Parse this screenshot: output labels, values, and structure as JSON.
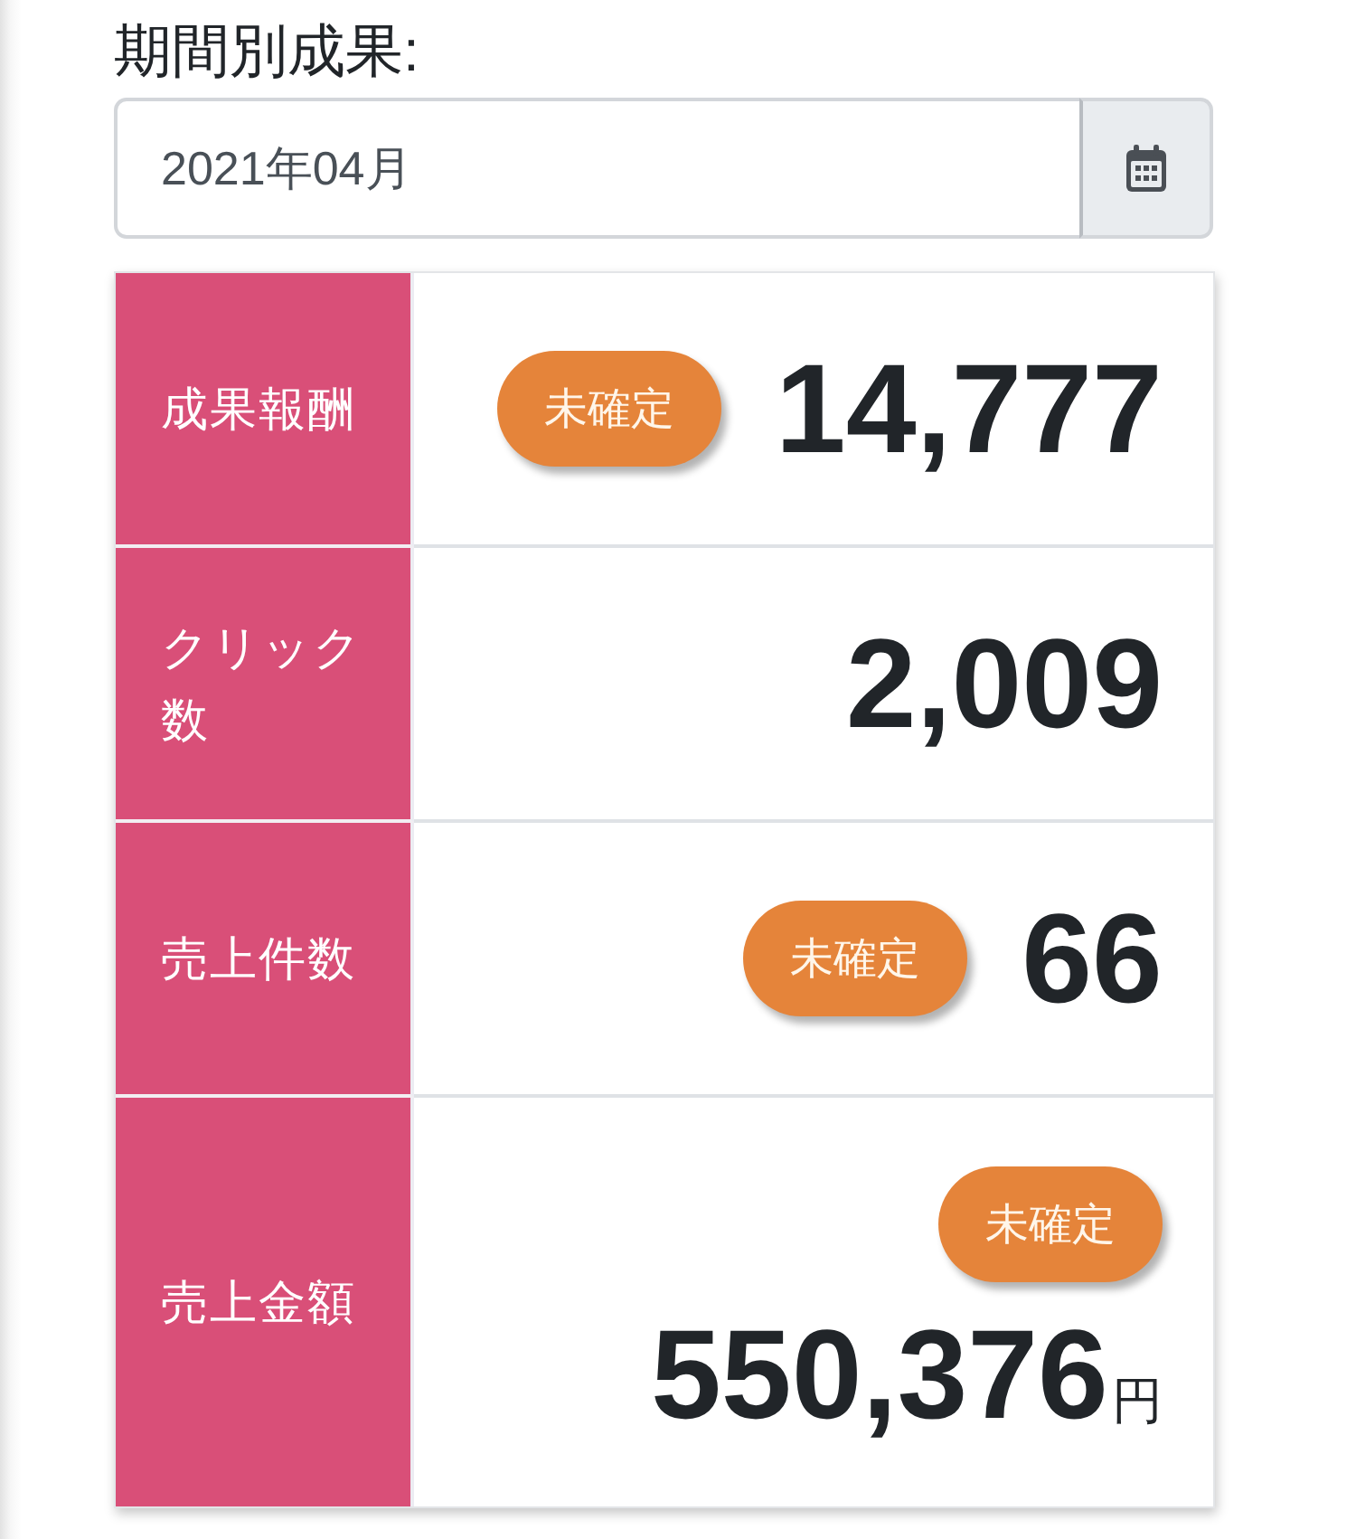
{
  "filter": {
    "label": "期間別成果:",
    "value": "2021年04月"
  },
  "metrics": [
    {
      "label": "成果報酬",
      "badge": "未確定",
      "value": "14,777"
    },
    {
      "label": "クリック数",
      "value": "2,009"
    },
    {
      "label": "売上件数",
      "badge": "未確定",
      "value": "66"
    },
    {
      "label": "売上金額",
      "badge": "未確定",
      "value": "550,376",
      "unit": "円"
    }
  ]
}
